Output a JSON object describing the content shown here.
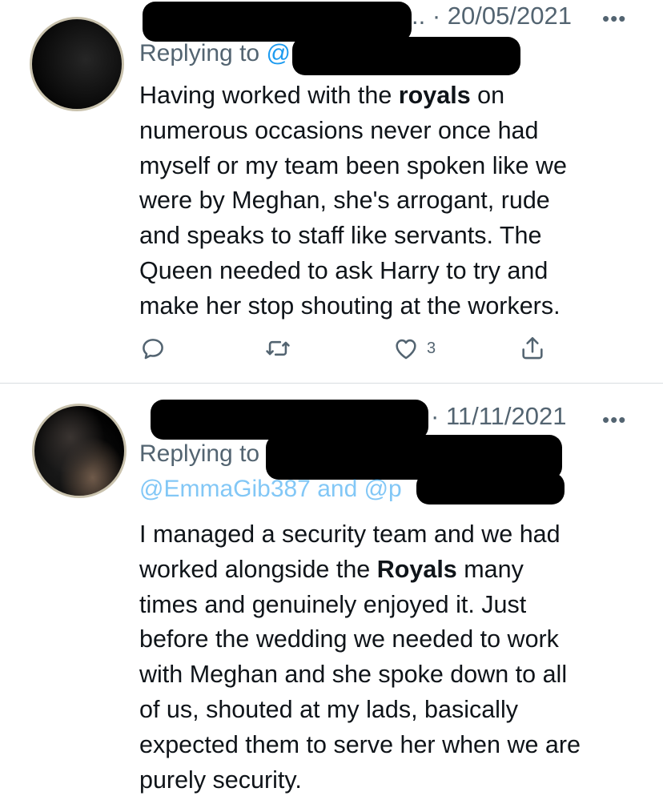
{
  "tweets": [
    {
      "date": "20/05/2021",
      "ellipsis": "..",
      "more_glyph": "•••",
      "replying_prefix": "Replying to",
      "replying_visible_tail": "@",
      "text_parts": [
        [
          "Having worked with the ",
          "royals",
          " on"
        ],
        [
          "numerous occasions never once had"
        ],
        [
          "myself or my team been spoken like we"
        ],
        [
          "were by Meghan, she's arrogant, rude"
        ],
        [
          "and speaks to staff like servants. The"
        ],
        [
          "Queen needed to ask Harry to try and"
        ],
        [
          "make her stop shouting at the workers."
        ]
      ],
      "actions": {
        "reply_icon": "reply-icon",
        "retweet_icon": "retweet-icon",
        "like_icon": "heart-icon",
        "like_count": "3",
        "share_icon": "share-icon"
      }
    },
    {
      "date": "11/11/2021",
      "more_glyph": "•••",
      "replying_prefix": "Replying to",
      "replying_second_line": "@EmmaGib387 and @p",
      "text_parts": [
        [
          "I managed a security team and we had"
        ],
        [
          "worked alongside the ",
          "Royals",
          " many"
        ],
        [
          "times and genuinely enjoyed it. Just"
        ],
        [
          "before the wedding we needed to work"
        ],
        [
          "with Meghan and she spoke down to all"
        ],
        [
          "of us, shouted at my lads, basically"
        ],
        [
          "expected them to serve her when we are"
        ],
        [
          "purely security."
        ]
      ]
    }
  ],
  "colors": {
    "text": "#0f1419",
    "muted": "#536471",
    "link": "#1d9bf0",
    "divider": "#d9dde1",
    "background": "#ffffff"
  }
}
